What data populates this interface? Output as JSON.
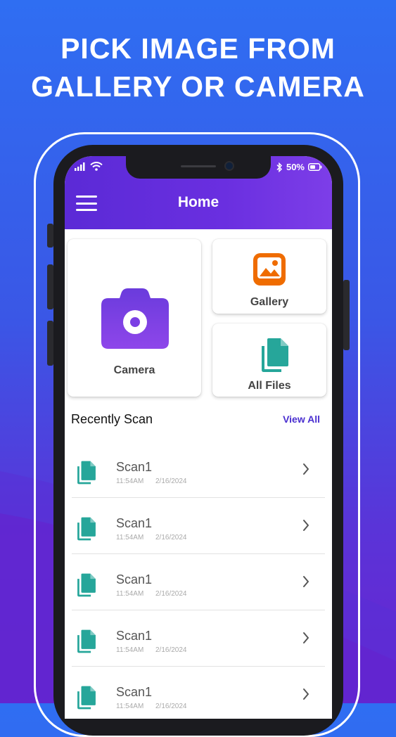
{
  "headline": {
    "line1": "PICK IMAGE FROM",
    "line2": "GALLERY OR CAMERA"
  },
  "status_bar": {
    "battery_text": "50%",
    "icons": [
      "signal-icon",
      "wifi-icon",
      "bluetooth-icon",
      "battery-icon"
    ]
  },
  "appbar": {
    "title": "Home",
    "menu_icon": "hamburger-menu-icon"
  },
  "actions": {
    "camera": {
      "label": "Camera",
      "icon": "camera-icon",
      "color": "#7b3fe4"
    },
    "gallery": {
      "label": "Gallery",
      "icon": "image-icon",
      "color": "#ef6c00"
    },
    "all_files": {
      "label": "All Files",
      "icon": "files-icon",
      "color": "#26a69a"
    }
  },
  "recent": {
    "title": "Recently Scan",
    "view_all": "View All",
    "items": [
      {
        "name": "Scan1",
        "time": "11:54AM",
        "date": "2/16/2024"
      },
      {
        "name": "Scan1",
        "time": "11:54AM",
        "date": "2/16/2024"
      },
      {
        "name": "Scan1",
        "time": "11:54AM",
        "date": "2/16/2024"
      },
      {
        "name": "Scan1",
        "time": "11:54AM",
        "date": "2/16/2024"
      },
      {
        "name": "Scan1",
        "time": "11:54AM",
        "date": "2/16/2024"
      }
    ]
  },
  "colors": {
    "accent": "#5b2ad6",
    "link": "#4a2fd0",
    "background_top": "#2f6ef2",
    "background_bottom": "#6a22d0"
  }
}
